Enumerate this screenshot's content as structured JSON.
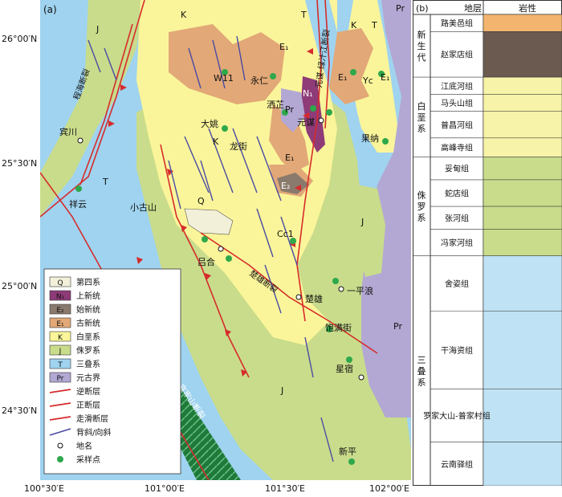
{
  "panel_a": "(a)",
  "panel_b": "(b)",
  "lat_labels": [
    "26°00′N",
    "25°30′N",
    "25°00′N",
    "24°30′N"
  ],
  "lon_labels": [
    "100°30′E",
    "101°00′E",
    "101°30′E",
    "102°00′E"
  ],
  "geo_units": {
    "K": "K",
    "T": "T",
    "J": "J",
    "E1": "E₁",
    "E2": "E₂",
    "N1": "N₁",
    "Pr": "Pr",
    "Q": "Q"
  },
  "places": {
    "binchuan": "宾川",
    "xiangyun": "祥云",
    "xiaogushan": "小古山",
    "lvhe": "吕合",
    "dayao": "大姚",
    "longjie": "龙街",
    "yongren": "永仁",
    "sazhuang": "洒芷",
    "yuanmou": "元谋",
    "guona": "果纳",
    "chuxiong": "楚雄",
    "baomanjie": "饱满街",
    "yipinglang": "一平浪",
    "xingsu": "星宿",
    "xinping": "新平"
  },
  "samples": {
    "w11": "W11",
    "cc1": "Cc1",
    "yc": "Yc"
  },
  "faults": {
    "chenghai": "程海断裂",
    "yuanmou": "元谋-绿汁江断裂",
    "chuxiong": "楚雄断裂",
    "ailao": "红河-哀牢山断裂"
  },
  "legend": [
    {
      "code": "Q",
      "label": "第四系",
      "color": "#f3f0d9"
    },
    {
      "code": "N₁",
      "label": "上新统",
      "color": "#8e3b78"
    },
    {
      "code": "E₂",
      "label": "始新统",
      "color": "#8a7a6d"
    },
    {
      "code": "E₁",
      "label": "古新统",
      "color": "#e2a877"
    },
    {
      "code": "K",
      "label": "白垩系",
      "color": "#faf59a"
    },
    {
      "code": "J",
      "label": "侏罗系",
      "color": "#c9dc8b"
    },
    {
      "code": "T",
      "label": "三叠系",
      "color": "#9fd3ef"
    },
    {
      "code": "Pr",
      "label": "元古界",
      "color": "#b3a8d3"
    }
  ],
  "legend_symbols": {
    "thrust": "逆断层",
    "normal": "正断层",
    "strike_slip": "走滑断层",
    "fold": "背斜/向斜",
    "place": "地名",
    "sample": "采样点"
  },
  "strat_header": {
    "layer": "地层",
    "lithology": "岩性"
  },
  "systems": [
    {
      "name": "新生代"
    },
    {
      "name": "白垩系"
    },
    {
      "name": "侏罗系"
    },
    {
      "name": "三叠系"
    }
  ],
  "formations": [
    {
      "name": "路美邑组",
      "color": "#f2b46e"
    },
    {
      "name": "赵家店组",
      "color": "#6a5a50"
    },
    {
      "name": "江底河组",
      "color": "#f7f3a8"
    },
    {
      "name": "马头山组",
      "color": "#f7f3a8"
    },
    {
      "name": "普昌河组",
      "color": "#f7f3a8"
    },
    {
      "name": "高峰寺组",
      "color": "#f7f3a8"
    },
    {
      "name": "妥甸组",
      "color": "#c9dc8b"
    },
    {
      "name": "蛇店组",
      "color": "#c9dc8b"
    },
    {
      "name": "张河组",
      "color": "#c9dc8b"
    },
    {
      "name": "冯家河组",
      "color": "#c9dc8b"
    },
    {
      "name": "舍姿组",
      "color": "#bfe2f4"
    },
    {
      "name": "干海资组",
      "color": "#bfe2f4"
    },
    {
      "name": "罗家大山-普家村组",
      "color": "#bfe2f4"
    },
    {
      "name": "云南驿组",
      "color": "#bfe2f4"
    }
  ]
}
